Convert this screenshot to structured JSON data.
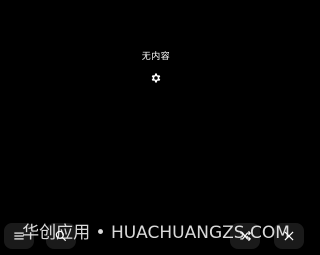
{
  "empty_state": {
    "message": "无内容",
    "settings_icon": "gear-icon"
  },
  "bottom_bar": {
    "buttons": [
      {
        "icon": "menu-icon"
      },
      {
        "icon": "search-icon"
      },
      {
        "icon": "shuffle-icon"
      },
      {
        "icon": "close-icon"
      }
    ]
  },
  "watermark": "华创应用 • HUACHUANGZS.COM",
  "colors": {
    "background": "#000000",
    "text": "#ffffff"
  }
}
